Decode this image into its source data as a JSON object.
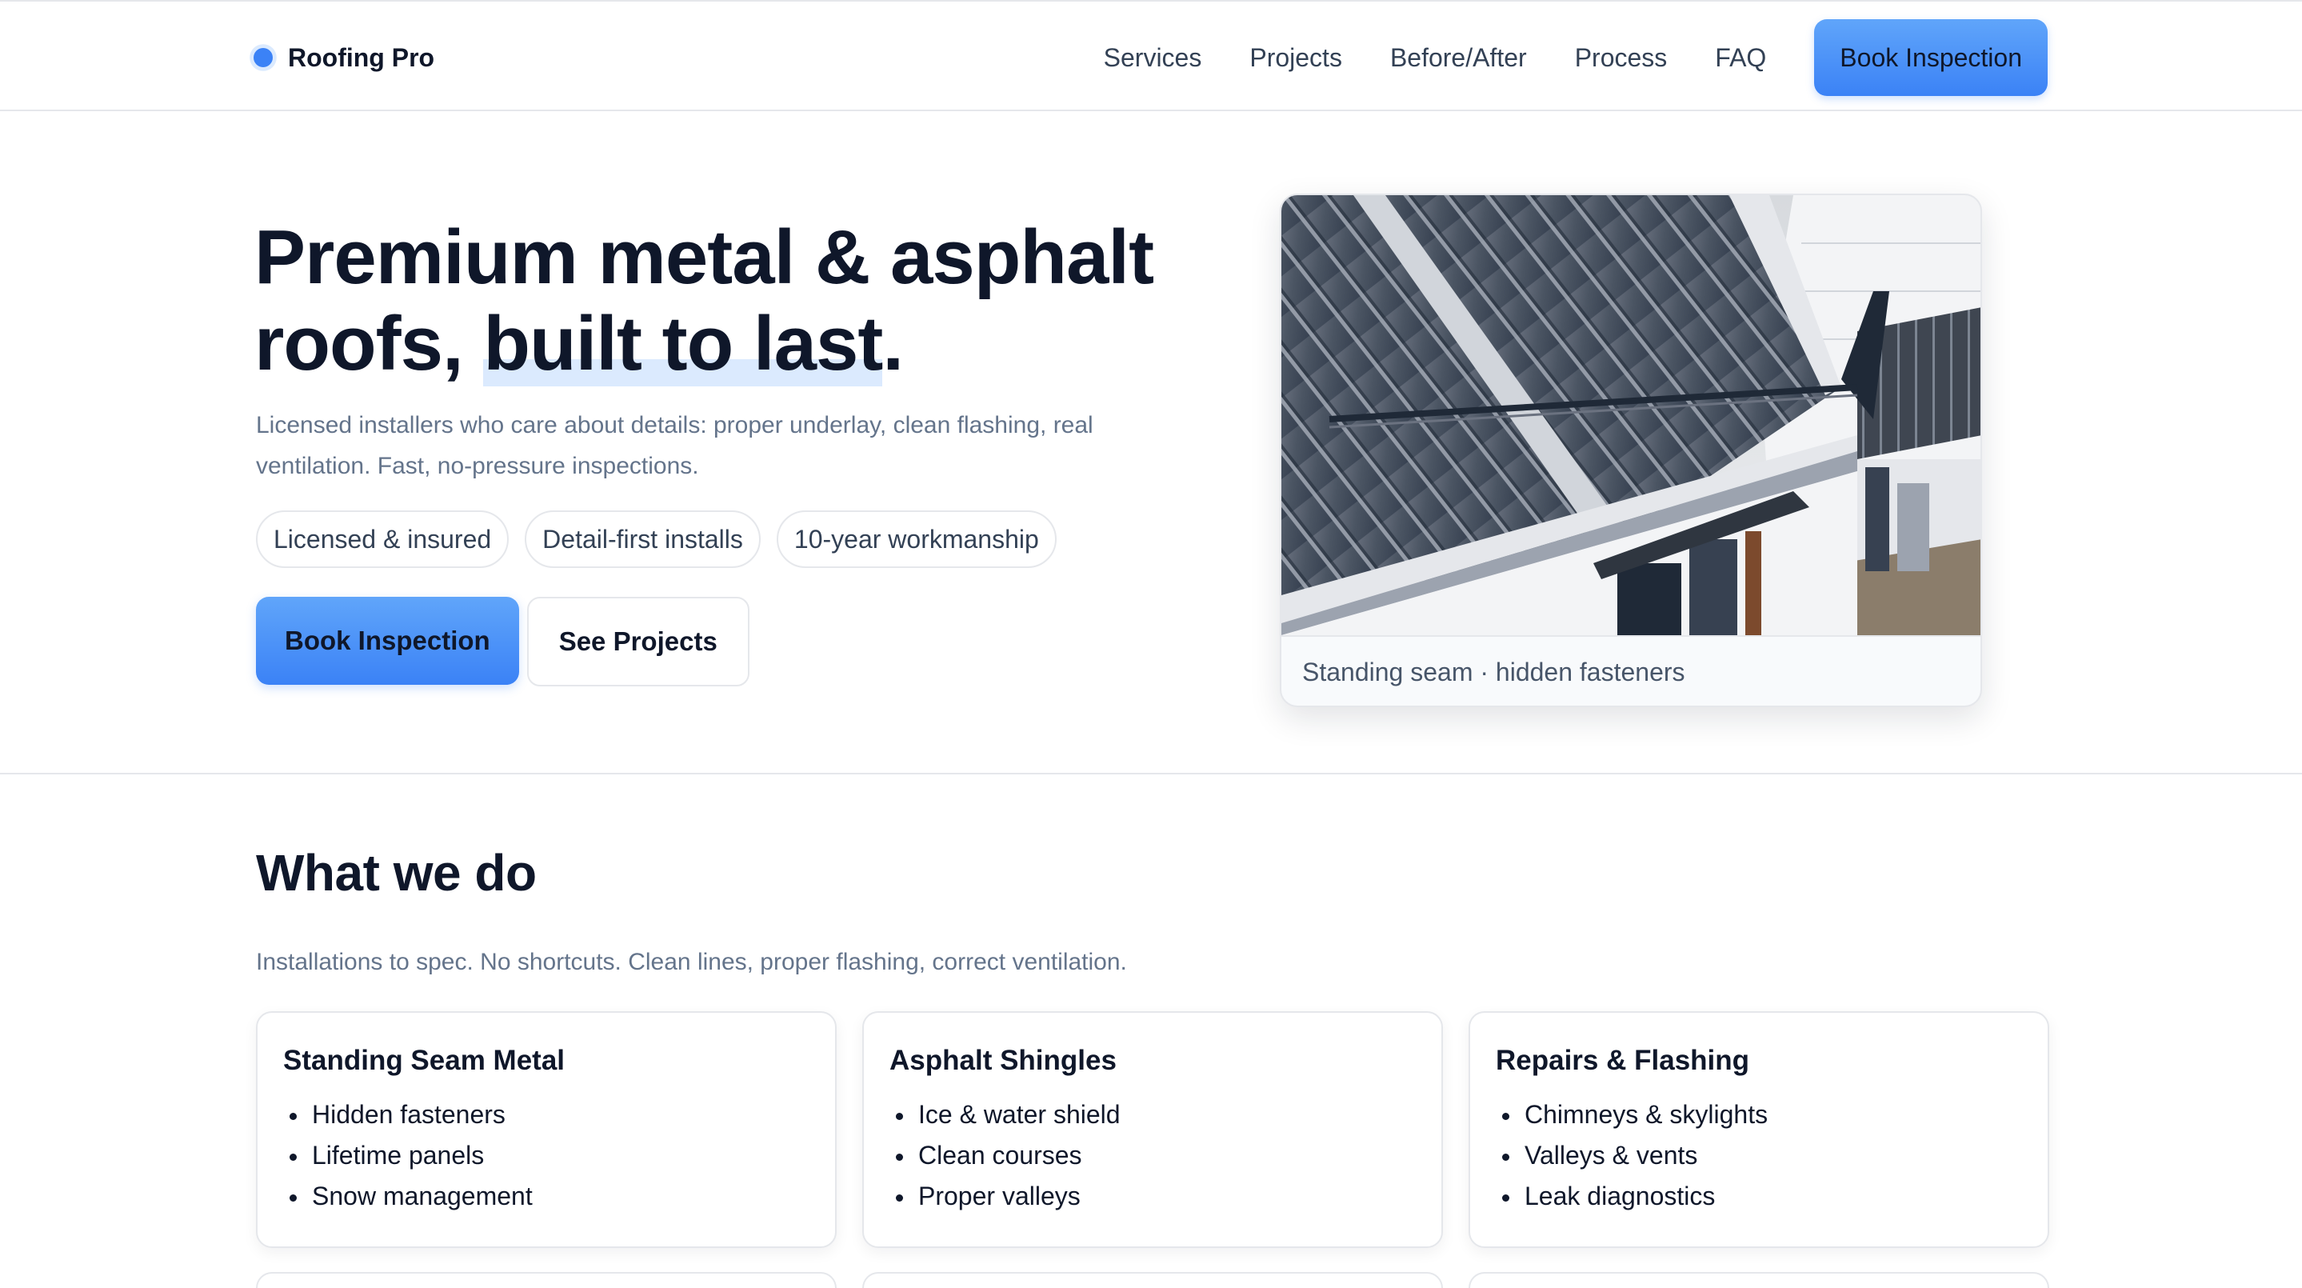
{
  "header": {
    "brand": "Roofing Pro",
    "nav": [
      "Services",
      "Projects",
      "Before/After",
      "Process",
      "FAQ"
    ],
    "cta": "Book Inspection"
  },
  "hero": {
    "title_line1": "Premium metal & asphalt",
    "title_line2_start": "roofs, ",
    "title_highlight": "built to last",
    "title_end": ".",
    "subtitle": "Licensed installers who care about details: proper underlay, clean flashing, real ventilation. Fast, no-pressure inspections.",
    "pills": [
      "Licensed & insured",
      "Detail-first installs",
      "10-year workmanship"
    ],
    "primary_cta": "Book Inspection",
    "secondary_cta": "See Projects",
    "image_caption": "Standing seam · hidden fasteners"
  },
  "services": {
    "title": "What we do",
    "subtitle": "Installations to spec. No shortcuts. Clean lines, proper flashing, correct ventilation.",
    "cards": [
      {
        "title": "Standing Seam Metal",
        "items": [
          "Hidden fasteners",
          "Lifetime panels",
          "Snow management"
        ]
      },
      {
        "title": "Asphalt Shingles",
        "items": [
          "Ice & water shield",
          "Clean courses",
          "Proper valleys"
        ]
      },
      {
        "title": "Repairs & Flashing",
        "items": [
          "Chimneys & skylights",
          "Valleys & vents",
          "Leak diagnostics"
        ]
      }
    ]
  },
  "colors": {
    "accent": "#3b82f6",
    "accent_light": "#60a5fa",
    "text": "#0f172a",
    "muted": "#64748b",
    "border": "#e5e7eb"
  }
}
